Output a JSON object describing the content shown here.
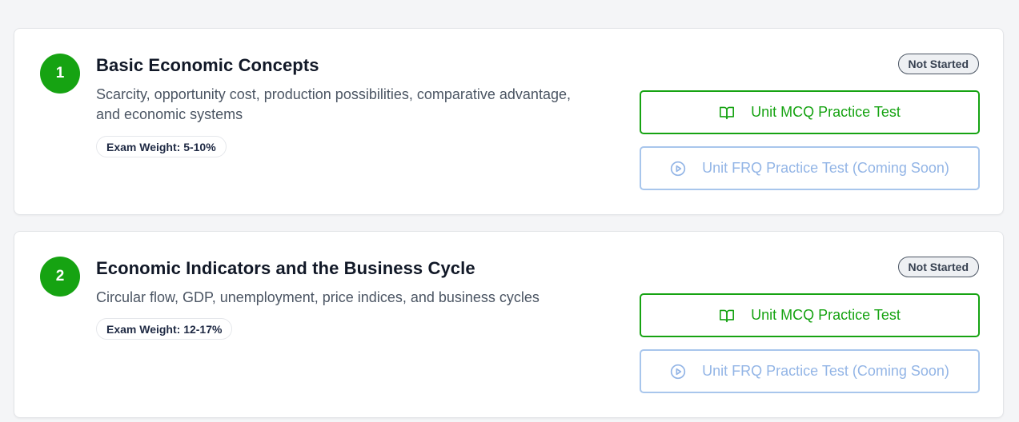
{
  "units": [
    {
      "number": "1",
      "title": "Basic Economic Concepts",
      "description": "Scarcity, opportunity cost, production possibilities, comparative advantage, and economic systems",
      "exam_weight": "Exam Weight: 5-10%",
      "status": "Not Started",
      "mcq_label": "Unit MCQ Practice Test",
      "frq_label": "Unit FRQ Practice Test (Coming Soon)"
    },
    {
      "number": "2",
      "title": "Economic Indicators and the Business Cycle",
      "description": "Circular flow, GDP, unemployment, price indices, and business cycles",
      "exam_weight": "Exam Weight: 12-17%",
      "status": "Not Started",
      "mcq_label": "Unit MCQ Practice Test",
      "frq_label": "Unit FRQ Practice Test (Coming Soon)"
    }
  ],
  "icons": {
    "mcq": "book-open-icon",
    "frq": "play-circle-icon"
  },
  "colors": {
    "accent_green": "#16a312",
    "disabled_blue": "#93b5e6"
  }
}
